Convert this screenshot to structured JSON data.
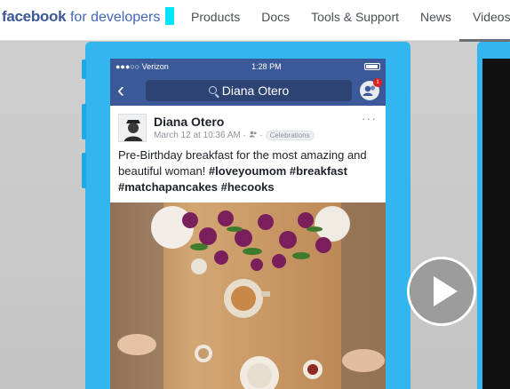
{
  "nav": {
    "brand_bold": "facebook",
    "brand_rest": "for developers",
    "links": [
      "Products",
      "Docs",
      "Tools & Support",
      "News",
      "Videos"
    ]
  },
  "phone": {
    "status": {
      "carrier": "●●●○○ Verizon",
      "time": "1:28 PM"
    },
    "search": {
      "query": "Diana Otero"
    },
    "notification_count": "1",
    "post": {
      "author": "Diana Otero",
      "date": "March 12 at 10:36 AM",
      "separator": "·",
      "tag": "Celebrations",
      "more": "···",
      "text_plain": "Pre-Birthday breakfast for the most amazing and beautiful woman! ",
      "text_hashtags": "#loveyoumom #breakfast #matchapancakes #hecooks"
    }
  },
  "colors": {
    "fb_blue": "#3b5998",
    "phone_body": "#33b5f0",
    "cursor": "#00e5ff"
  },
  "icons": [
    "back-chevron-icon",
    "search-icon",
    "friends-icon",
    "audience-icon",
    "play-icon"
  ]
}
